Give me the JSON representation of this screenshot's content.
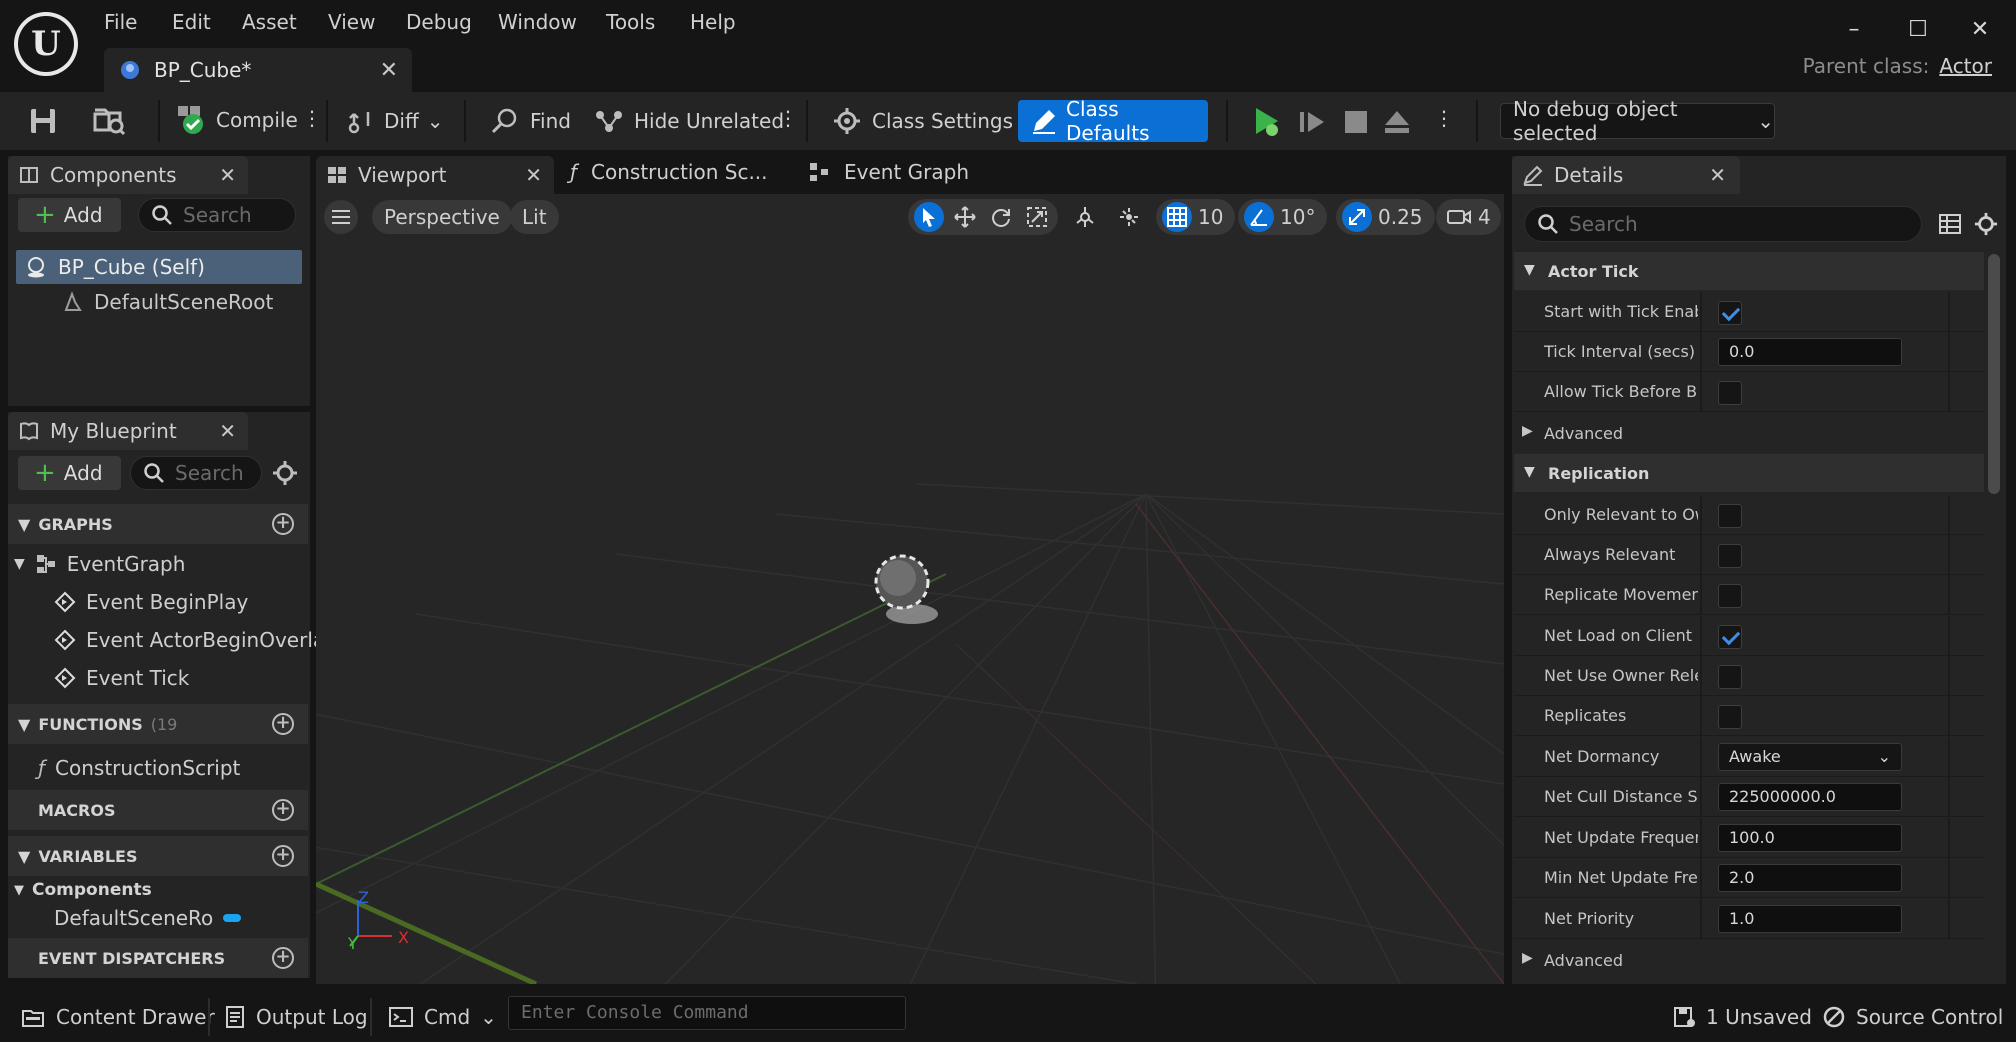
{
  "app": {
    "menu": [
      "File",
      "Edit",
      "Asset",
      "View",
      "Debug",
      "Window",
      "Tools",
      "Help"
    ],
    "document_tab": "BP_Cube*",
    "parent_class_label": "Parent class:",
    "parent_class_value": "Actor"
  },
  "toolbar": {
    "compile": "Compile",
    "diff": "Diff",
    "find": "Find",
    "hide_unrelated": "Hide Unrelated",
    "class_settings": "Class Settings",
    "class_defaults": "Class Defaults",
    "debug_object": "No debug object selected"
  },
  "components": {
    "title": "Components",
    "add": "Add",
    "search_placeholder": "Search",
    "self": "BP_Cube (Self)",
    "root": "DefaultSceneRoot"
  },
  "my_blueprint": {
    "title": "My Blueprint",
    "add": "Add",
    "search_placeholder": "Search",
    "graphs_header": "GRAPHS",
    "event_graph": "EventGraph",
    "events": [
      "Event BeginPlay",
      "Event ActorBeginOverlap",
      "Event Tick"
    ],
    "functions_header": "FUNCTIONS",
    "functions_count": "(19",
    "construction_script": "ConstructionScript",
    "macros_header": "MACROS",
    "variables_header": "VARIABLES",
    "components_category": "Components",
    "default_scene_root_var": "DefaultSceneRo",
    "event_dispatchers_header": "EVENT DISPATCHERS"
  },
  "viewport": {
    "tabs": [
      "Viewport",
      "Construction Sc...",
      "Event Graph"
    ],
    "perspective": "Perspective",
    "lit": "Lit",
    "grid_snap": "10",
    "rotation_snap": "10°",
    "scale_snap": "0.25",
    "camera_speed": "4",
    "axis_x": "X",
    "axis_y": "Y",
    "axis_z": "Z"
  },
  "details": {
    "title": "Details",
    "search_placeholder": "Search",
    "actor_tick": {
      "header": "Actor Tick",
      "start_with_tick": {
        "label": "Start with Tick Enab...",
        "checked": true
      },
      "tick_interval": {
        "label": "Tick Interval (secs)",
        "value": "0.0"
      },
      "allow_tick_before": {
        "label": "Allow Tick Before B...",
        "checked": false
      },
      "advanced": "Advanced"
    },
    "replication": {
      "header": "Replication",
      "only_relevant": {
        "label": "Only Relevant to Ow...",
        "checked": false
      },
      "always_relevant": {
        "label": "Always Relevant",
        "checked": false
      },
      "replicate_movement": {
        "label": "Replicate Movement",
        "checked": false
      },
      "net_load_on_client": {
        "label": "Net Load on Client",
        "checked": true
      },
      "net_use_owner": {
        "label": "Net Use Owner Rele...",
        "checked": false
      },
      "replicates": {
        "label": "Replicates",
        "checked": false
      },
      "net_dormancy": {
        "label": "Net Dormancy",
        "value": "Awake"
      },
      "net_cull_distance": {
        "label": "Net Cull Distance Sq...",
        "value": "225000000.0"
      },
      "net_update_freq": {
        "label": "Net Update Frequen...",
        "value": "100.0"
      },
      "min_net_update": {
        "label": "Min Net Update Fre...",
        "value": "2.0"
      },
      "net_priority": {
        "label": "Net Priority",
        "value": "1.0"
      },
      "advanced": "Advanced"
    }
  },
  "statusbar": {
    "content_drawer": "Content Drawer",
    "output_log": "Output Log",
    "cmd": "Cmd",
    "console_placeholder": "Enter Console Command",
    "unsaved": "1 Unsaved",
    "source_control": "Source Control"
  },
  "colors": {
    "accent_blue": "#0b70d6",
    "selection": "#4a6179",
    "panel": "#242424",
    "background": "#151515"
  }
}
